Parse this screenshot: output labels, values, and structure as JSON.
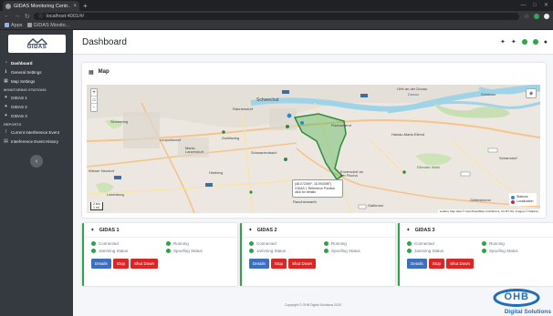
{
  "browser": {
    "tab_title": "GIDAS Monitoring Centr...",
    "tab_close": "×",
    "tab_new": "+",
    "url": "localhost:4001/#/",
    "bookmarks": [
      "Apps",
      "GIDAS Monito..."
    ]
  },
  "sidebar": {
    "logo": "GIDAS",
    "items": [
      {
        "label": "Dashboard",
        "icon": "gauge-icon"
      },
      {
        "label": "General Settings",
        "icon": "info-icon"
      },
      {
        "label": "Map Settings",
        "icon": "map-icon"
      }
    ],
    "stations_heading": "MONITORING STATIONS",
    "stations": [
      "GIDAS 1",
      "GIDAS 2",
      "GIDAS 3"
    ],
    "reports_heading": "REPORTS",
    "reports": [
      "Current Interference Event",
      "Interference Event History"
    ],
    "toggle": "‹"
  },
  "header": {
    "title": "Dashboard"
  },
  "map": {
    "title": "Map",
    "zoom_in": "+",
    "zoom_out": "-",
    "places": [
      {
        "name": "Orth an der Donau",
        "blue": false
      },
      {
        "name": "Schwechat",
        "blue": false
      },
      {
        "name": "Rannersdorf",
        "blue": false
      },
      {
        "name": "Fischamend",
        "blue": false
      },
      {
        "name": "Haslau-Maria Ellend",
        "blue": false
      },
      {
        "name": "Simmering",
        "blue": false
      },
      {
        "name": "Leopoldsdorf",
        "blue": false
      },
      {
        "name": "Zwölfaxing",
        "blue": false
      },
      {
        "name": "Maria-Lanzendorf",
        "blue": false
      },
      {
        "name": "Himberg",
        "blue": false
      },
      {
        "name": "Wiener Neudorf",
        "blue": false
      },
      {
        "name": "Laxenburg",
        "blue": false
      },
      {
        "name": "Gallbrunn",
        "blue": false
      },
      {
        "name": "Scharndorf",
        "blue": false
      },
      {
        "name": "Göttlesbrunn",
        "blue": false
      },
      {
        "name": "Ellender Wald",
        "blue": false
      },
      {
        "name": "Schwarzenbach",
        "blue": false
      },
      {
        "name": "Rauchenwarth",
        "blue": false
      },
      {
        "name": "Enzersdorf an der Fischa",
        "blue": false
      },
      {
        "name": "Donau",
        "blue": true
      },
      {
        "name": "Schönau",
        "blue": false
      }
    ],
    "popup_lines": [
      "(48.072069°, 16.593398°)",
      "GIDAS 1 Reference Position",
      "click for details"
    ],
    "legend": {
      "stations": "Stations",
      "localization": "Localization"
    },
    "scale": "2 km",
    "scale_imperial": "1 mi",
    "attribution": "Leaflet | Map data © OpenStreetMap contributors, CC-BY-SA, Imagery © Mapbox"
  },
  "stations": [
    {
      "name": "GIDAS 1",
      "connected": "Connected",
      "running": "Running",
      "jamming": "Jamming Status",
      "spoofing": "Spoofing Status",
      "details": "Details",
      "stop": "Stop",
      "shutdown": "Shut Down"
    },
    {
      "name": "GIDAS 2",
      "connected": "Connected",
      "running": "Running",
      "jamming": "Jamming Status",
      "spoofing": "Spoofing Status",
      "details": "Details",
      "stop": "Stop",
      "shutdown": "Shut Down"
    },
    {
      "name": "GIDAS 3",
      "connected": "Connected",
      "running": "Running",
      "jamming": "Jamming Status",
      "spoofing": "Spoofing Status",
      "details": "Details",
      "stop": "Stop",
      "shutdown": "Shut Down"
    }
  ],
  "footer": {
    "copyright": "Copyright © OHB Digital Solutions 2020"
  },
  "branding": {
    "company": "OHB",
    "tagline": "Digital Solutions"
  },
  "colors": {
    "sidebar": "#343a40",
    "status_green": "#28a745",
    "button_blue": "#3a6fc4",
    "button_red": "#e02424",
    "area_green": "#5cb85c"
  }
}
